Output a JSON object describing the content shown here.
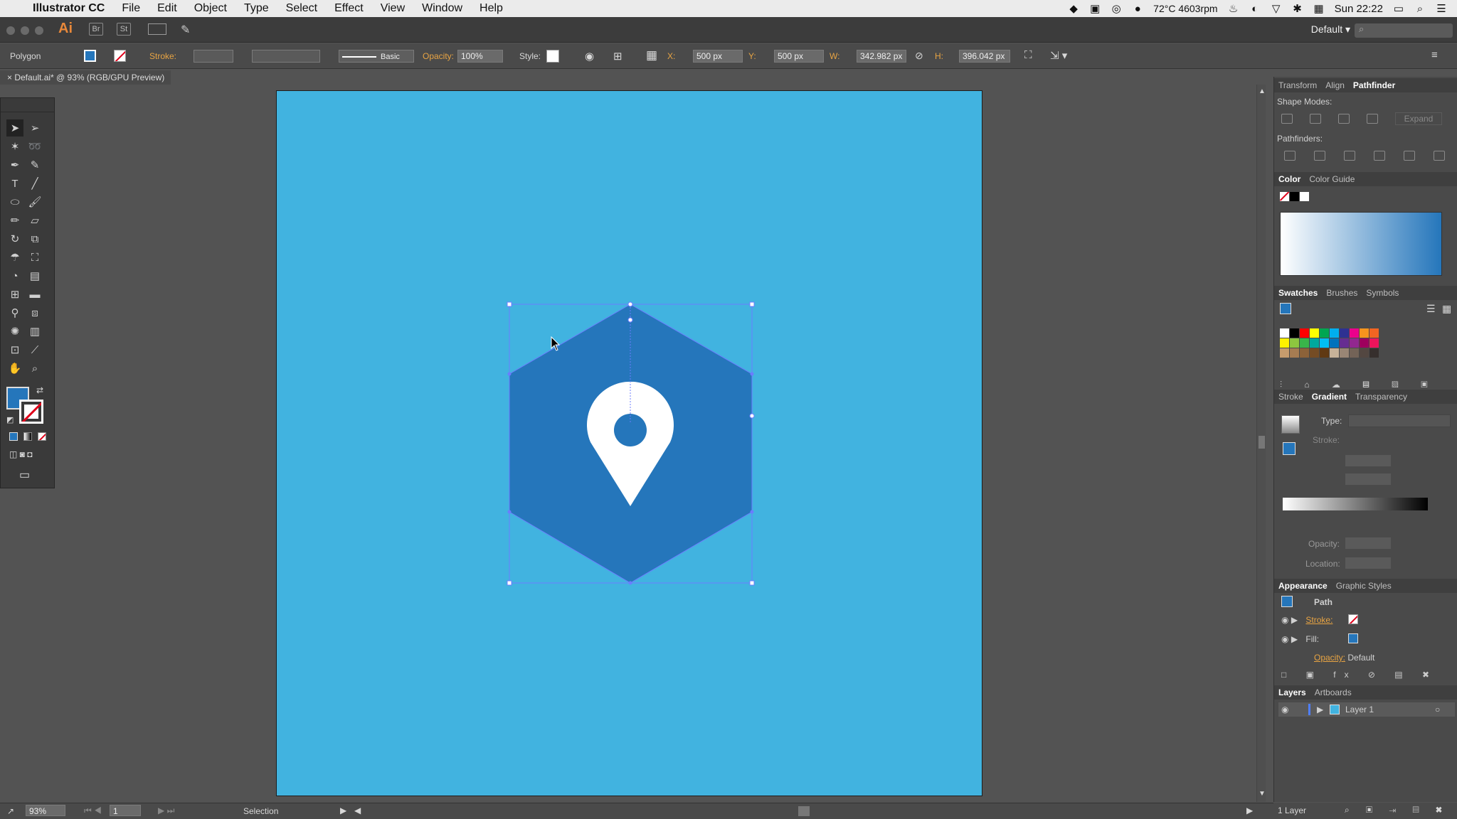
{
  "menubar": {
    "app_name": "Illustrator CC",
    "items": [
      "File",
      "Edit",
      "Object",
      "Type",
      "Select",
      "Effect",
      "View",
      "Window",
      "Help"
    ],
    "status_temp": "72°C 4603rpm",
    "clock": "Sun 22:22"
  },
  "appbar": {
    "logo": "Ai",
    "bridge": "Br",
    "stock": "St",
    "workspace": "Default"
  },
  "control": {
    "object_type": "Polygon",
    "stroke_label": "Stroke:",
    "stroke_style": "Basic",
    "opacity_label": "Opacity:",
    "opacity_value": "100%",
    "style_label": "Style:",
    "x_label": "X:",
    "x_value": "500 px",
    "y_label": "Y:",
    "y_value": "500 px",
    "w_label": "W:",
    "w_value": "342.982 px",
    "h_label": "H:",
    "h_value": "396.042 px"
  },
  "document": {
    "tab_title": "Default.ai* @ 93% (RGB/GPU Preview)"
  },
  "artwork": {
    "artboard_color": "#41b3e0",
    "hexagon_color": "#2576bb",
    "pin_color": "#ffffff",
    "selection_color": "#6c7cff"
  },
  "panels": {
    "top_tabs": [
      "Transform",
      "Align",
      "Pathfinder"
    ],
    "shape_modes_label": "Shape Modes:",
    "expand_label": "Expand",
    "pathfinders_label": "Pathfinders:",
    "color_tabs": [
      "Color",
      "Color Guide"
    ],
    "swatch_tabs": [
      "Swatches",
      "Brushes",
      "Symbols"
    ],
    "gradient_tabs": [
      "Stroke",
      "Gradient",
      "Transparency"
    ],
    "type_label": "Type:",
    "stroke_label": "Stroke:",
    "opacity_label": "Opacity:",
    "location_label": "Location:",
    "appearance_tabs": [
      "Appearance",
      "Graphic Styles"
    ],
    "appearance_path": "Path",
    "appearance_stroke": "Stroke:",
    "appearance_fill": "Fill:",
    "appearance_opacity": "Opacity:",
    "appearance_opacity_value": "Default",
    "layers_tabs": [
      "Layers",
      "Artboards"
    ],
    "layer_name": "Layer 1",
    "layer_count": "1 Layer"
  },
  "status": {
    "zoom": "93%",
    "artboard_num": "1",
    "tool_name": "Selection"
  },
  "swatch_colors": [
    "#ffffff",
    "#000000",
    "#ff0000",
    "#ffff00",
    "#00a651",
    "#00aeef",
    "#2e3192",
    "#ec008c",
    "#f7941d",
    "#f26522",
    "#fff200",
    "#8dc63f",
    "#39b54a",
    "#00a99d",
    "#00bff3",
    "#0072bc",
    "#662d91",
    "#92278f",
    "#9e005d",
    "#ed145b",
    "#c69c6d",
    "#a67c52",
    "#8c6239",
    "#754c24",
    "#603913",
    "#c7b299",
    "#998675",
    "#736357",
    "#534741",
    "#362f2d"
  ]
}
